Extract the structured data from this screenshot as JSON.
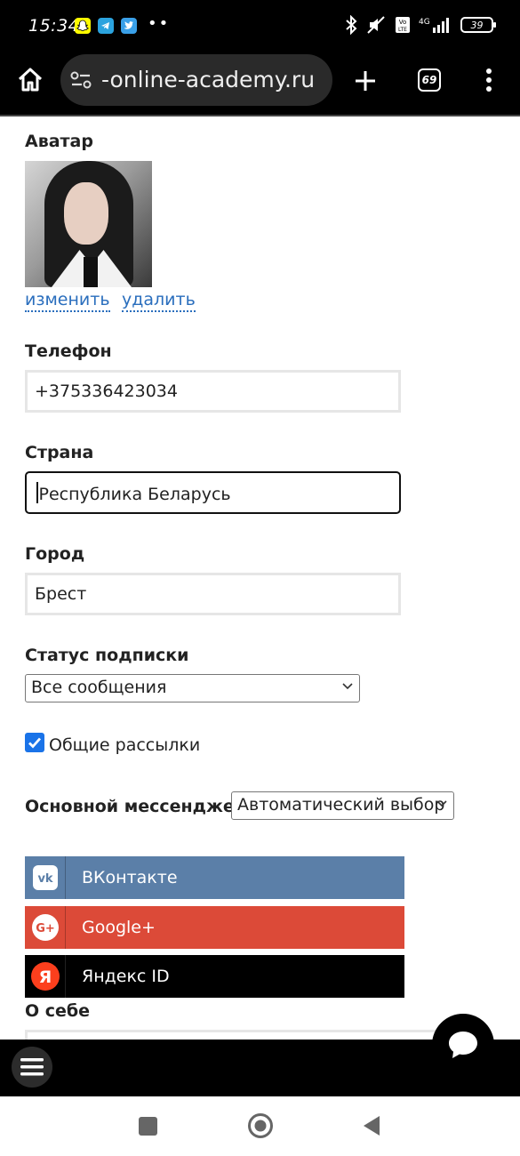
{
  "status_bar": {
    "time": "15:34",
    "battery": "39",
    "icons": [
      "snapchat-icon",
      "telegram-icon",
      "twitter-icon",
      "more-dots-icon",
      "bluetooth-icon",
      "mute-icon",
      "volte-icon",
      "signal-icon",
      "battery-icon"
    ],
    "more_dots": "••"
  },
  "browser": {
    "url": "-online-academy.ru",
    "tab_count": "69",
    "icons": [
      "home-icon",
      "site-settings-icon",
      "new-tab-plus-icon",
      "tabs-icon",
      "menu-dots-icon"
    ]
  },
  "form": {
    "avatar": {
      "label": "Аватар",
      "change_link": "изменить",
      "delete_link": "удалить"
    },
    "phone": {
      "label": "Телефон",
      "value": "+375336423034"
    },
    "country": {
      "label": "Страна",
      "value": "Республика Беларусь"
    },
    "city": {
      "label": "Город",
      "value": "Брест"
    },
    "subscription": {
      "label": "Статус подписки",
      "selected": "Все сообщения"
    },
    "newsletter": {
      "label": "Общие рассылки",
      "checked": true
    },
    "messenger": {
      "label": "Основной мессенджер",
      "selected": "Автоматический выбор"
    },
    "social": [
      {
        "label": "ВКонтакте",
        "color": "#5b7fa8"
      },
      {
        "label": "Google+",
        "color": "#dc4a38"
      },
      {
        "label": "Яндекс ID",
        "color": "#000000"
      }
    ],
    "about": {
      "label": "О себе"
    }
  },
  "colors": {
    "link": "#2a6ebd",
    "checkbox": "#1a73e8"
  }
}
